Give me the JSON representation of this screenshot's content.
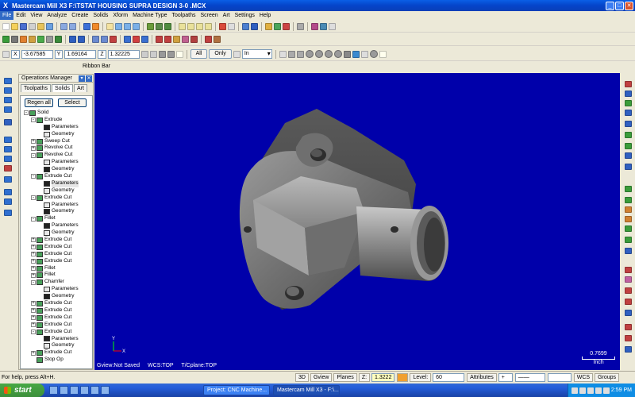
{
  "window": {
    "title": "Mastercam Mill X3  F:\\TSTAT HOUSING SUPRA  DESIGN 3-0  .MCX"
  },
  "menu": [
    "File",
    "Edit",
    "View",
    "Analyze",
    "Create",
    "Solids",
    "Xform",
    "Machine Type",
    "Toolpaths",
    "Screen",
    "Art",
    "Settings",
    "Help"
  ],
  "coords": {
    "x_label": "X",
    "x_value": "-3.67585",
    "y_label": "Y",
    "y_value": "1.69164",
    "z_label": "Z",
    "z_value": "1.32225",
    "all_button": "All",
    "only_button": "Only",
    "units_select": "In"
  },
  "ribbon_label": "Ribbon Bar",
  "ops_manager": {
    "title": "Operations Manager",
    "tabs": [
      "Toolpaths",
      "Solids",
      "Art"
    ],
    "regen_button": "Regen all",
    "select_button": "Select",
    "tree": [
      {
        "label": "Solid",
        "indent": 0,
        "exp": "-"
      },
      {
        "label": "Extrude",
        "indent": 1,
        "exp": "-"
      },
      {
        "label": "Parameters",
        "indent": 2,
        "exp": ""
      },
      {
        "label": "Geometry",
        "indent": 2,
        "exp": ""
      },
      {
        "label": "Sweep Cut",
        "indent": 1,
        "exp": "+"
      },
      {
        "label": "Revolve Cut",
        "indent": 1,
        "exp": "+"
      },
      {
        "label": "Revolve Cut",
        "indent": 1,
        "exp": "-"
      },
      {
        "label": "Parameters",
        "indent": 2,
        "exp": ""
      },
      {
        "label": "Geometry",
        "indent": 2,
        "exp": ""
      },
      {
        "label": "Extrude Cut",
        "indent": 1,
        "exp": "-"
      },
      {
        "label": "Parameters",
        "indent": 2,
        "exp": "",
        "sel": true
      },
      {
        "label": "Geometry",
        "indent": 2,
        "exp": ""
      },
      {
        "label": "Extrude Cut",
        "indent": 1,
        "exp": "-"
      },
      {
        "label": "Parameters",
        "indent": 2,
        "exp": ""
      },
      {
        "label": "Geometry",
        "indent": 2,
        "exp": ""
      },
      {
        "label": "Fillet",
        "indent": 1,
        "exp": "-"
      },
      {
        "label": "Parameters",
        "indent": 2,
        "exp": ""
      },
      {
        "label": "Geometry",
        "indent": 2,
        "exp": ""
      },
      {
        "label": "Extrude Cut",
        "indent": 1,
        "exp": "+"
      },
      {
        "label": "Extrude Cut",
        "indent": 1,
        "exp": "+"
      },
      {
        "label": "Extrude Cut",
        "indent": 1,
        "exp": "+"
      },
      {
        "label": "Extrude Cut",
        "indent": 1,
        "exp": "+"
      },
      {
        "label": "Fillet",
        "indent": 1,
        "exp": "+"
      },
      {
        "label": "Fillet",
        "indent": 1,
        "exp": "+"
      },
      {
        "label": "Chamfer",
        "indent": 1,
        "exp": "-"
      },
      {
        "label": "Parameters",
        "indent": 2,
        "exp": ""
      },
      {
        "label": "Geometry",
        "indent": 2,
        "exp": ""
      },
      {
        "label": "Extrude Cut",
        "indent": 1,
        "exp": "+"
      },
      {
        "label": "Extrude Cut",
        "indent": 1,
        "exp": "+"
      },
      {
        "label": "Extrude Cut",
        "indent": 1,
        "exp": "+"
      },
      {
        "label": "Extrude Cut",
        "indent": 1,
        "exp": "+"
      },
      {
        "label": "Extrude Cut",
        "indent": 1,
        "exp": "-"
      },
      {
        "label": "Parameters",
        "indent": 2,
        "exp": ""
      },
      {
        "label": "Geometry",
        "indent": 2,
        "exp": ""
      },
      {
        "label": "Extrude Cut",
        "indent": 1,
        "exp": "+"
      },
      {
        "label": "Stop Op",
        "indent": 1,
        "exp": ""
      }
    ]
  },
  "viewport": {
    "background": "#0000aa",
    "gview": "Gview:Not Saved",
    "wcs": "WCS:TOP",
    "tplane": "T/Cplane:TOP",
    "scale_value": "0.7699",
    "scale_unit": "Inch",
    "axis_x": "X",
    "axis_y": "Y"
  },
  "status": {
    "help": "For help, press Alt+H.",
    "btn_3d": "3D",
    "btn_gview": "Gview",
    "btn_planes": "Planes",
    "z_label": "Z:",
    "z_value": "1.3222",
    "level_label": "Level:",
    "level_value": "60",
    "attributes_label": "Attributes",
    "wcs_label": "WCS",
    "groups_label": "Groups"
  },
  "taskbar": {
    "start": "start",
    "tasks": [
      "Project: CNC Machine...",
      "Mastercam Mill X3 - F:\\..."
    ],
    "clock": "2:59 PM"
  }
}
